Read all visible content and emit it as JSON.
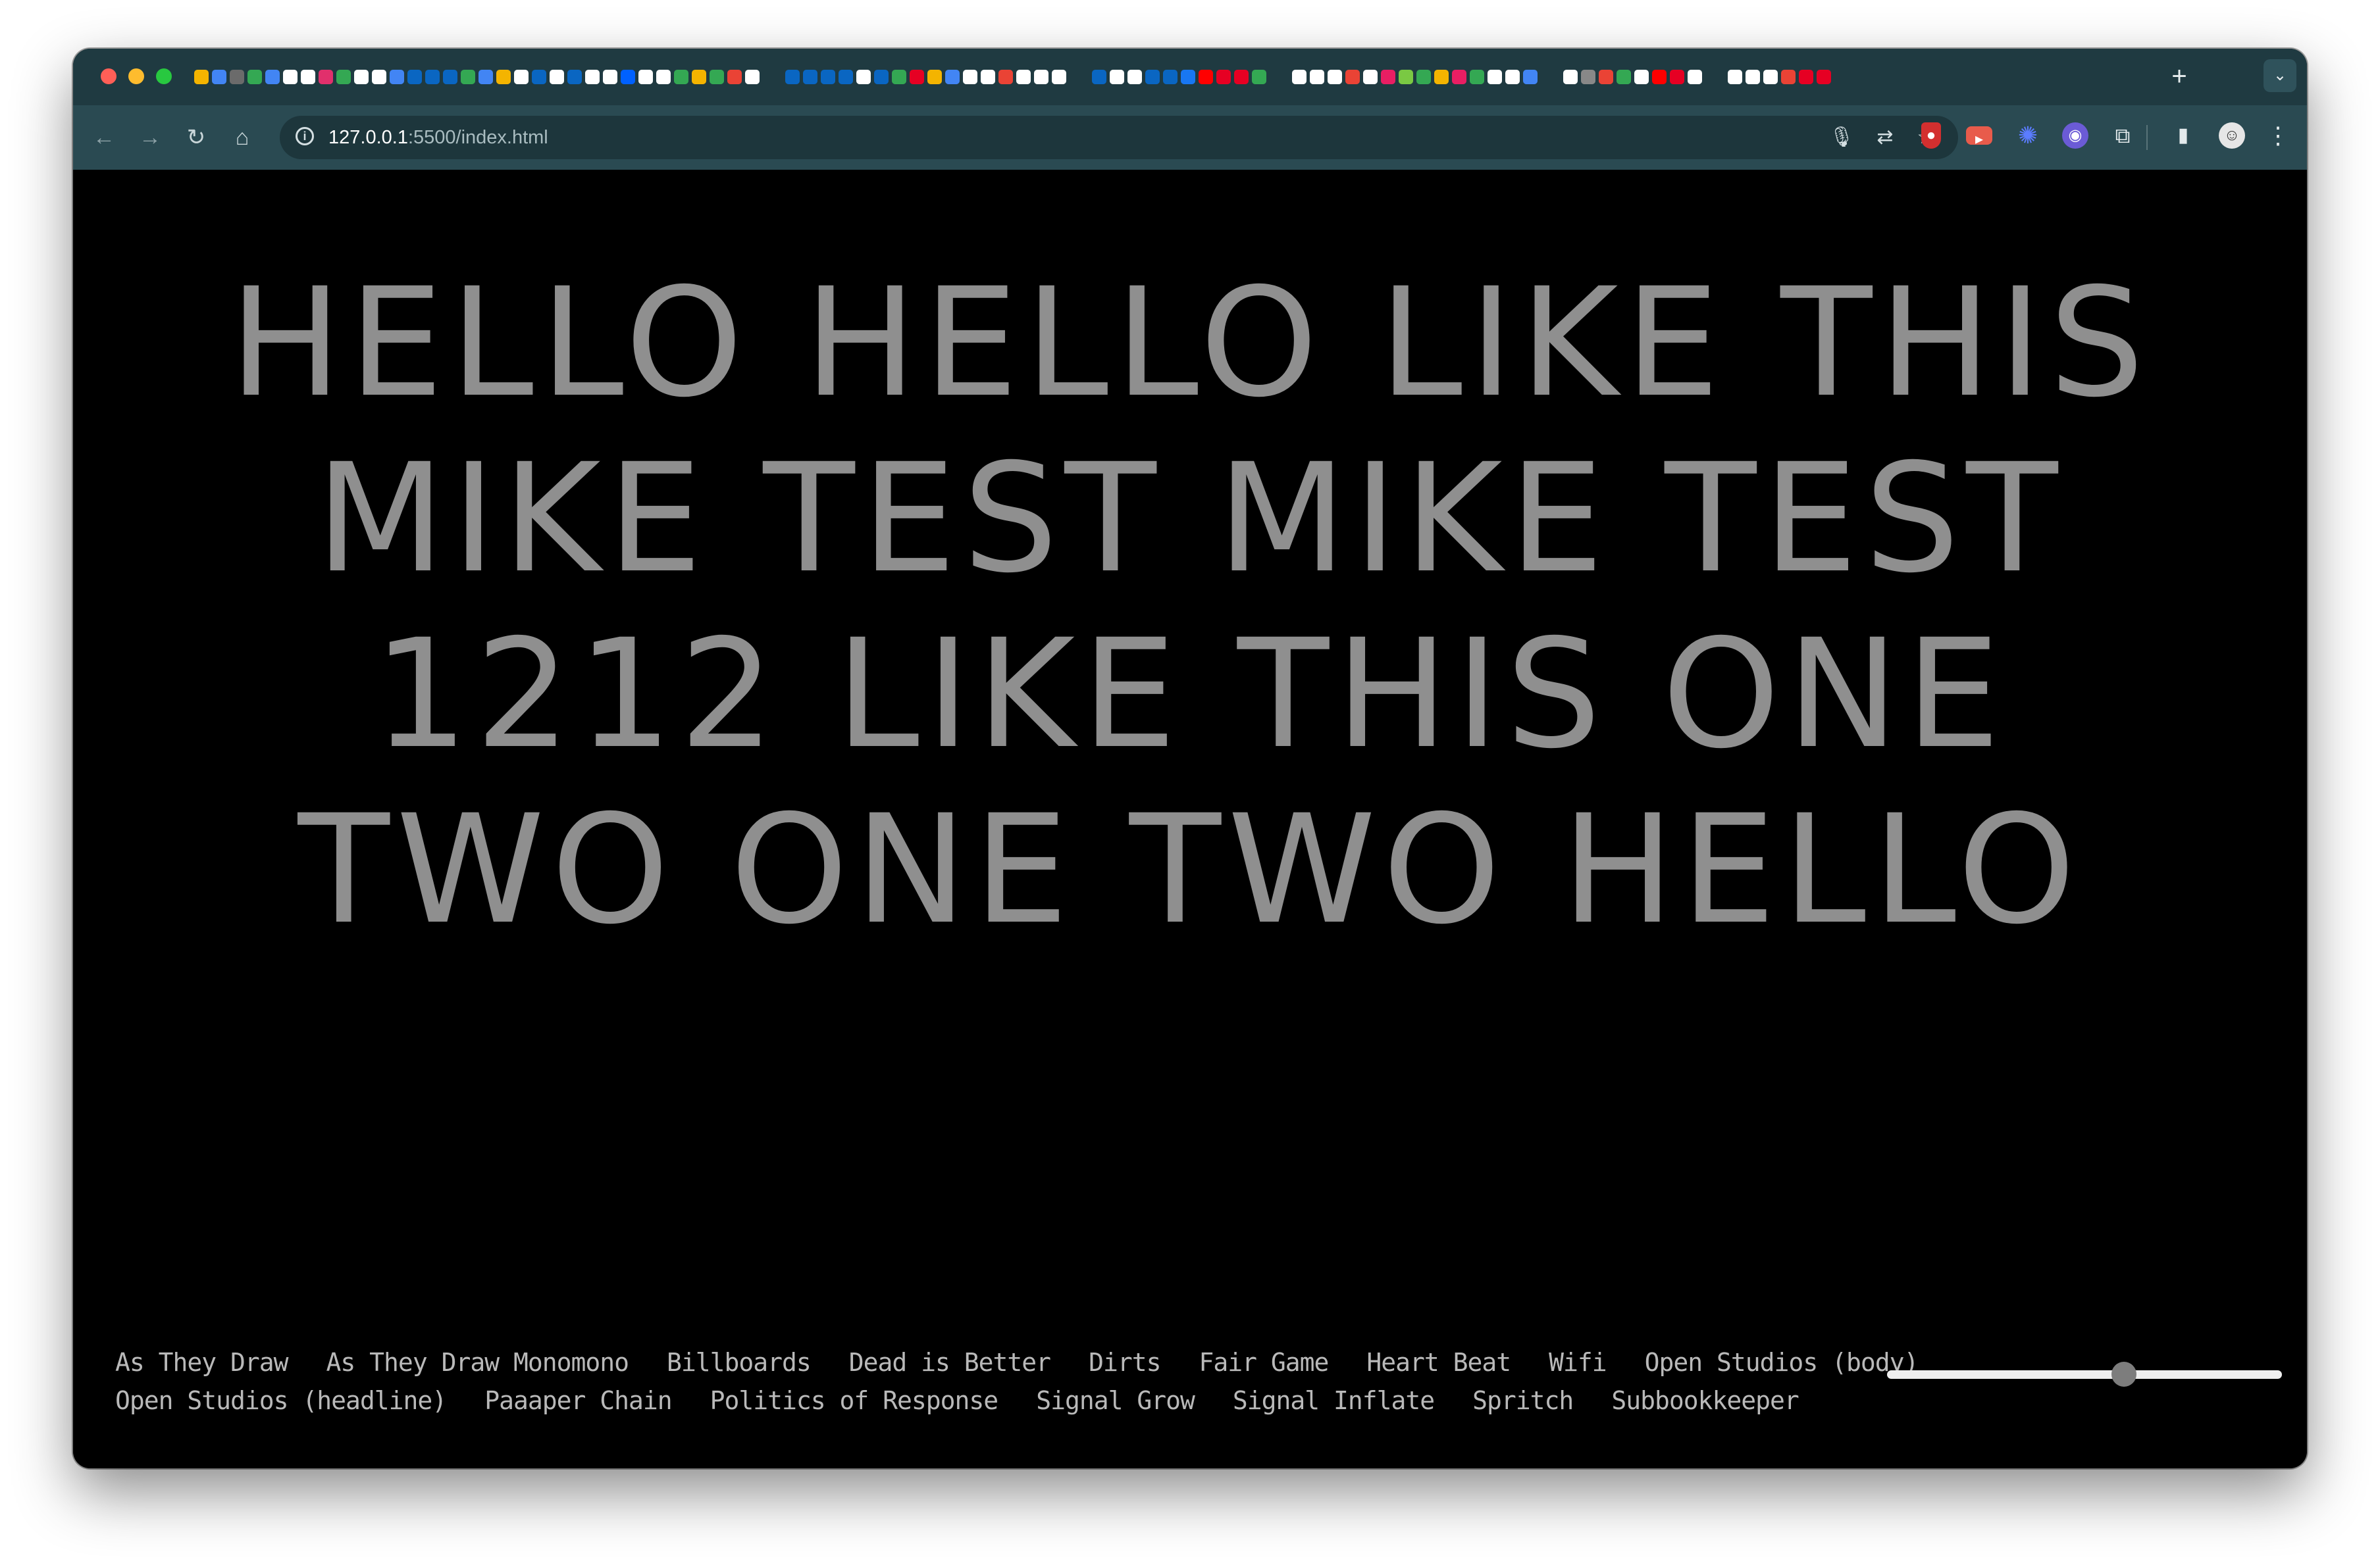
{
  "browser": {
    "address": {
      "host": "127.0.0.1",
      "rest": ":5500/index.html"
    },
    "tab_favicon_colors": [
      "#f4b400",
      "#4285f4",
      "#6b6b6b",
      "#34a853",
      "#4285f4",
      "#ffffff",
      "#ffffff",
      "#e1306c",
      "#34a853",
      "#ffffff",
      "#ffffff",
      "#4285f4",
      "#0a66c2",
      "#0a66c2",
      "#0a66c2",
      "#34a853",
      "#4285f4",
      "#f4b400",
      "#ffffff",
      "#0a66c2",
      "#ffffff",
      "#0a66c2",
      "#ffffff",
      "#ffffff",
      "#0061ff",
      "#ffffff",
      "#ffffff",
      "#34a853",
      "#f4b400",
      "#34a853",
      "#ea4335",
      "#ffffff",
      "#0a66c2",
      "#0a66c2",
      "#0a66c2",
      "#0a66c2",
      "#ffffff",
      "#0a66c2",
      "#34a853",
      "#e60023",
      "#f4b400",
      "#4285f4",
      "#ffffff",
      "#ffffff",
      "#ea4335",
      "#ffffff",
      "#ffffff",
      "#ffffff",
      "#0a66c2",
      "#ffffff",
      "#ffffff",
      "#0a66c2",
      "#0a66c2",
      "#1877f2",
      "#ff0000",
      "#e60023",
      "#e60023",
      "#34a853",
      "#ffffff",
      "#ffffff",
      "#ffffff",
      "#ea4335",
      "#ffffff",
      "#e91e63",
      "#7ac943",
      "#34a853",
      "#f4b400",
      "#e91e63",
      "#34a853",
      "#ffffff",
      "#ffffff",
      "#4285f4",
      "#ffffff",
      "#888888",
      "#ea4335",
      "#34a853",
      "#ffffff",
      "#ff0000",
      "#e60023",
      "#ffffff",
      "#ffffff",
      "#ffffff",
      "#ffffff",
      "#ea4335",
      "#e60023",
      "#e60023"
    ],
    "icons": {
      "back": "back-arrow-icon",
      "forward": "forward-arrow-icon",
      "reload": "reload-icon",
      "home": "home-icon",
      "info": "site-info-icon",
      "mic": "microphone-icon",
      "translate": "translate-icon",
      "star": "bookmark-star-icon",
      "new_tab": "plus-icon",
      "tab_search": "chevron-down-icon",
      "menu": "kebab-menu-icon"
    }
  },
  "headline": "HELLO HELLO LIKE THIS MIKE TEST MIKE TEST 1212 LIKE THIS ONE TWO ONE TWO HELLO",
  "font_rows": [
    [
      "As They Draw",
      "As They Draw Monomono",
      "Billboards",
      "Dead is Better",
      "Dirts",
      "Fair Game",
      "Heart Beat",
      "Wifi",
      "Open Studios (body)"
    ],
    [
      "Open Studios (headline)",
      "Paaaper Chain",
      "Politics of Response",
      "Signal Grow",
      "Signal Inflate",
      "Spritch",
      "Subbookkeeper"
    ]
  ],
  "size_slider": {
    "value_fraction": 0.6
  },
  "colors": {
    "page_background": "#000000",
    "headline_text": "#8f8f8f",
    "font_link_text": "#b9b9b9",
    "chrome_tabstrip": "#1f3a41",
    "chrome_toolbar": "#2a4a52"
  }
}
